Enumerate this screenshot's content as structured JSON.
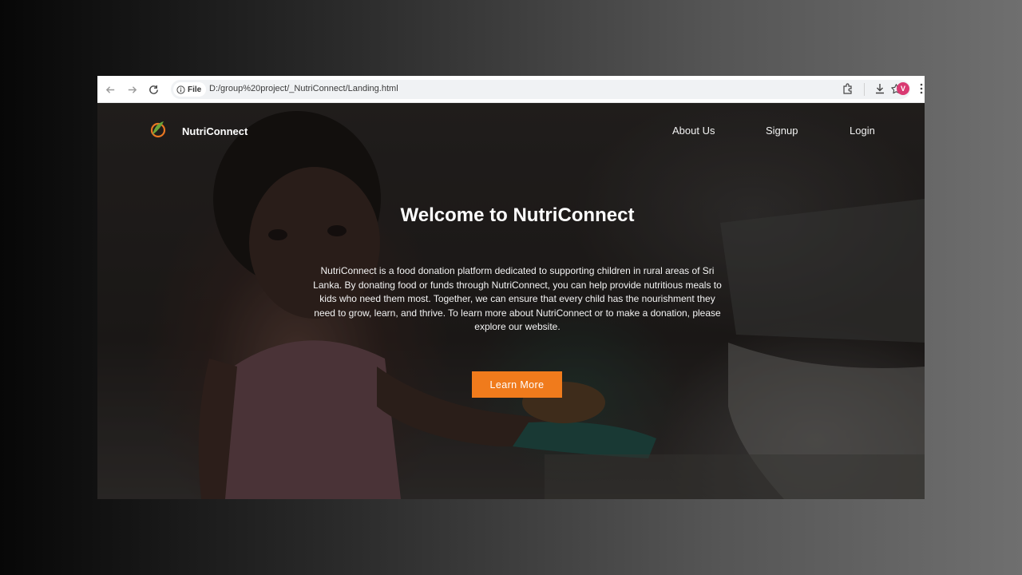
{
  "browser": {
    "site_chip": "File",
    "url": "D:/group%20project/_NutriConnect/Landing.html",
    "profile_initial": "V",
    "profile_color": "#d93a72"
  },
  "site": {
    "brand": "NutriConnect",
    "nav": {
      "about": "About Us",
      "signup": "Signup",
      "login": "Login"
    }
  },
  "hero": {
    "title": "Welcome to NutriConnect",
    "description": "NutriConnect is a food donation platform dedicated to supporting children in rural areas of Sri Lanka. By donating food or funds through NutriConnect, you can help provide nutritious meals to kids who need them most. Together, we can ensure that every child has the nourishment they need to grow, learn, and thrive. To learn more about NutriConnect or to make a donation, please explore our website.",
    "cta_label": "Learn More",
    "cta_color": "#f07b1c"
  }
}
